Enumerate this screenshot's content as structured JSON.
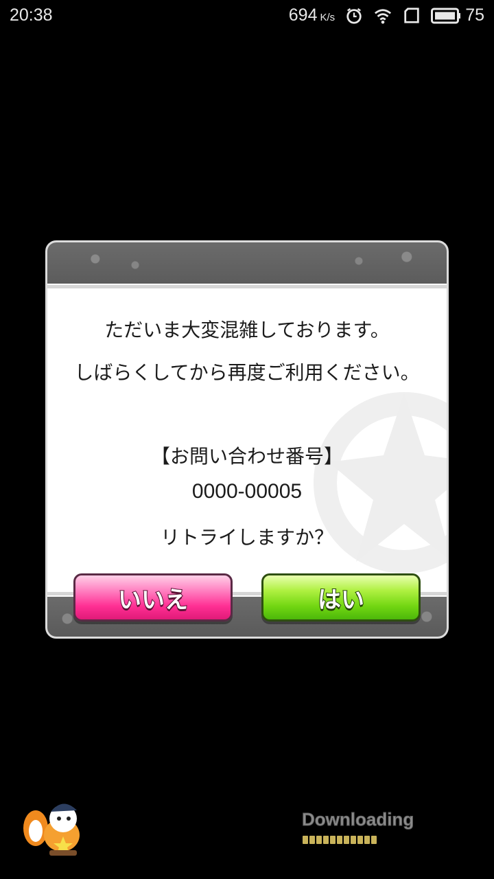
{
  "status_bar": {
    "time": "20:38",
    "net_speed": "694",
    "net_speed_unit": "K/s",
    "battery_level": "75",
    "icons": [
      "alarm-icon",
      "wifi-icon",
      "sim-icon",
      "battery-icon"
    ]
  },
  "dialog": {
    "message_line1": "ただいま大変混雑しております。",
    "message_line2": "しばらくしてから再度ご利用ください。",
    "inquiry_label": "【お問い合わせ番号】",
    "inquiry_number": "0000-00005",
    "retry_question": "リトライしますか？",
    "no_button": "いいえ",
    "yes_button": "はい"
  },
  "footer": {
    "download_label": "Downloading",
    "download_segments": 11
  },
  "colors": {
    "no_button": "#ff2f93",
    "yes_button": "#72d612",
    "progress": "#c9b35a"
  }
}
